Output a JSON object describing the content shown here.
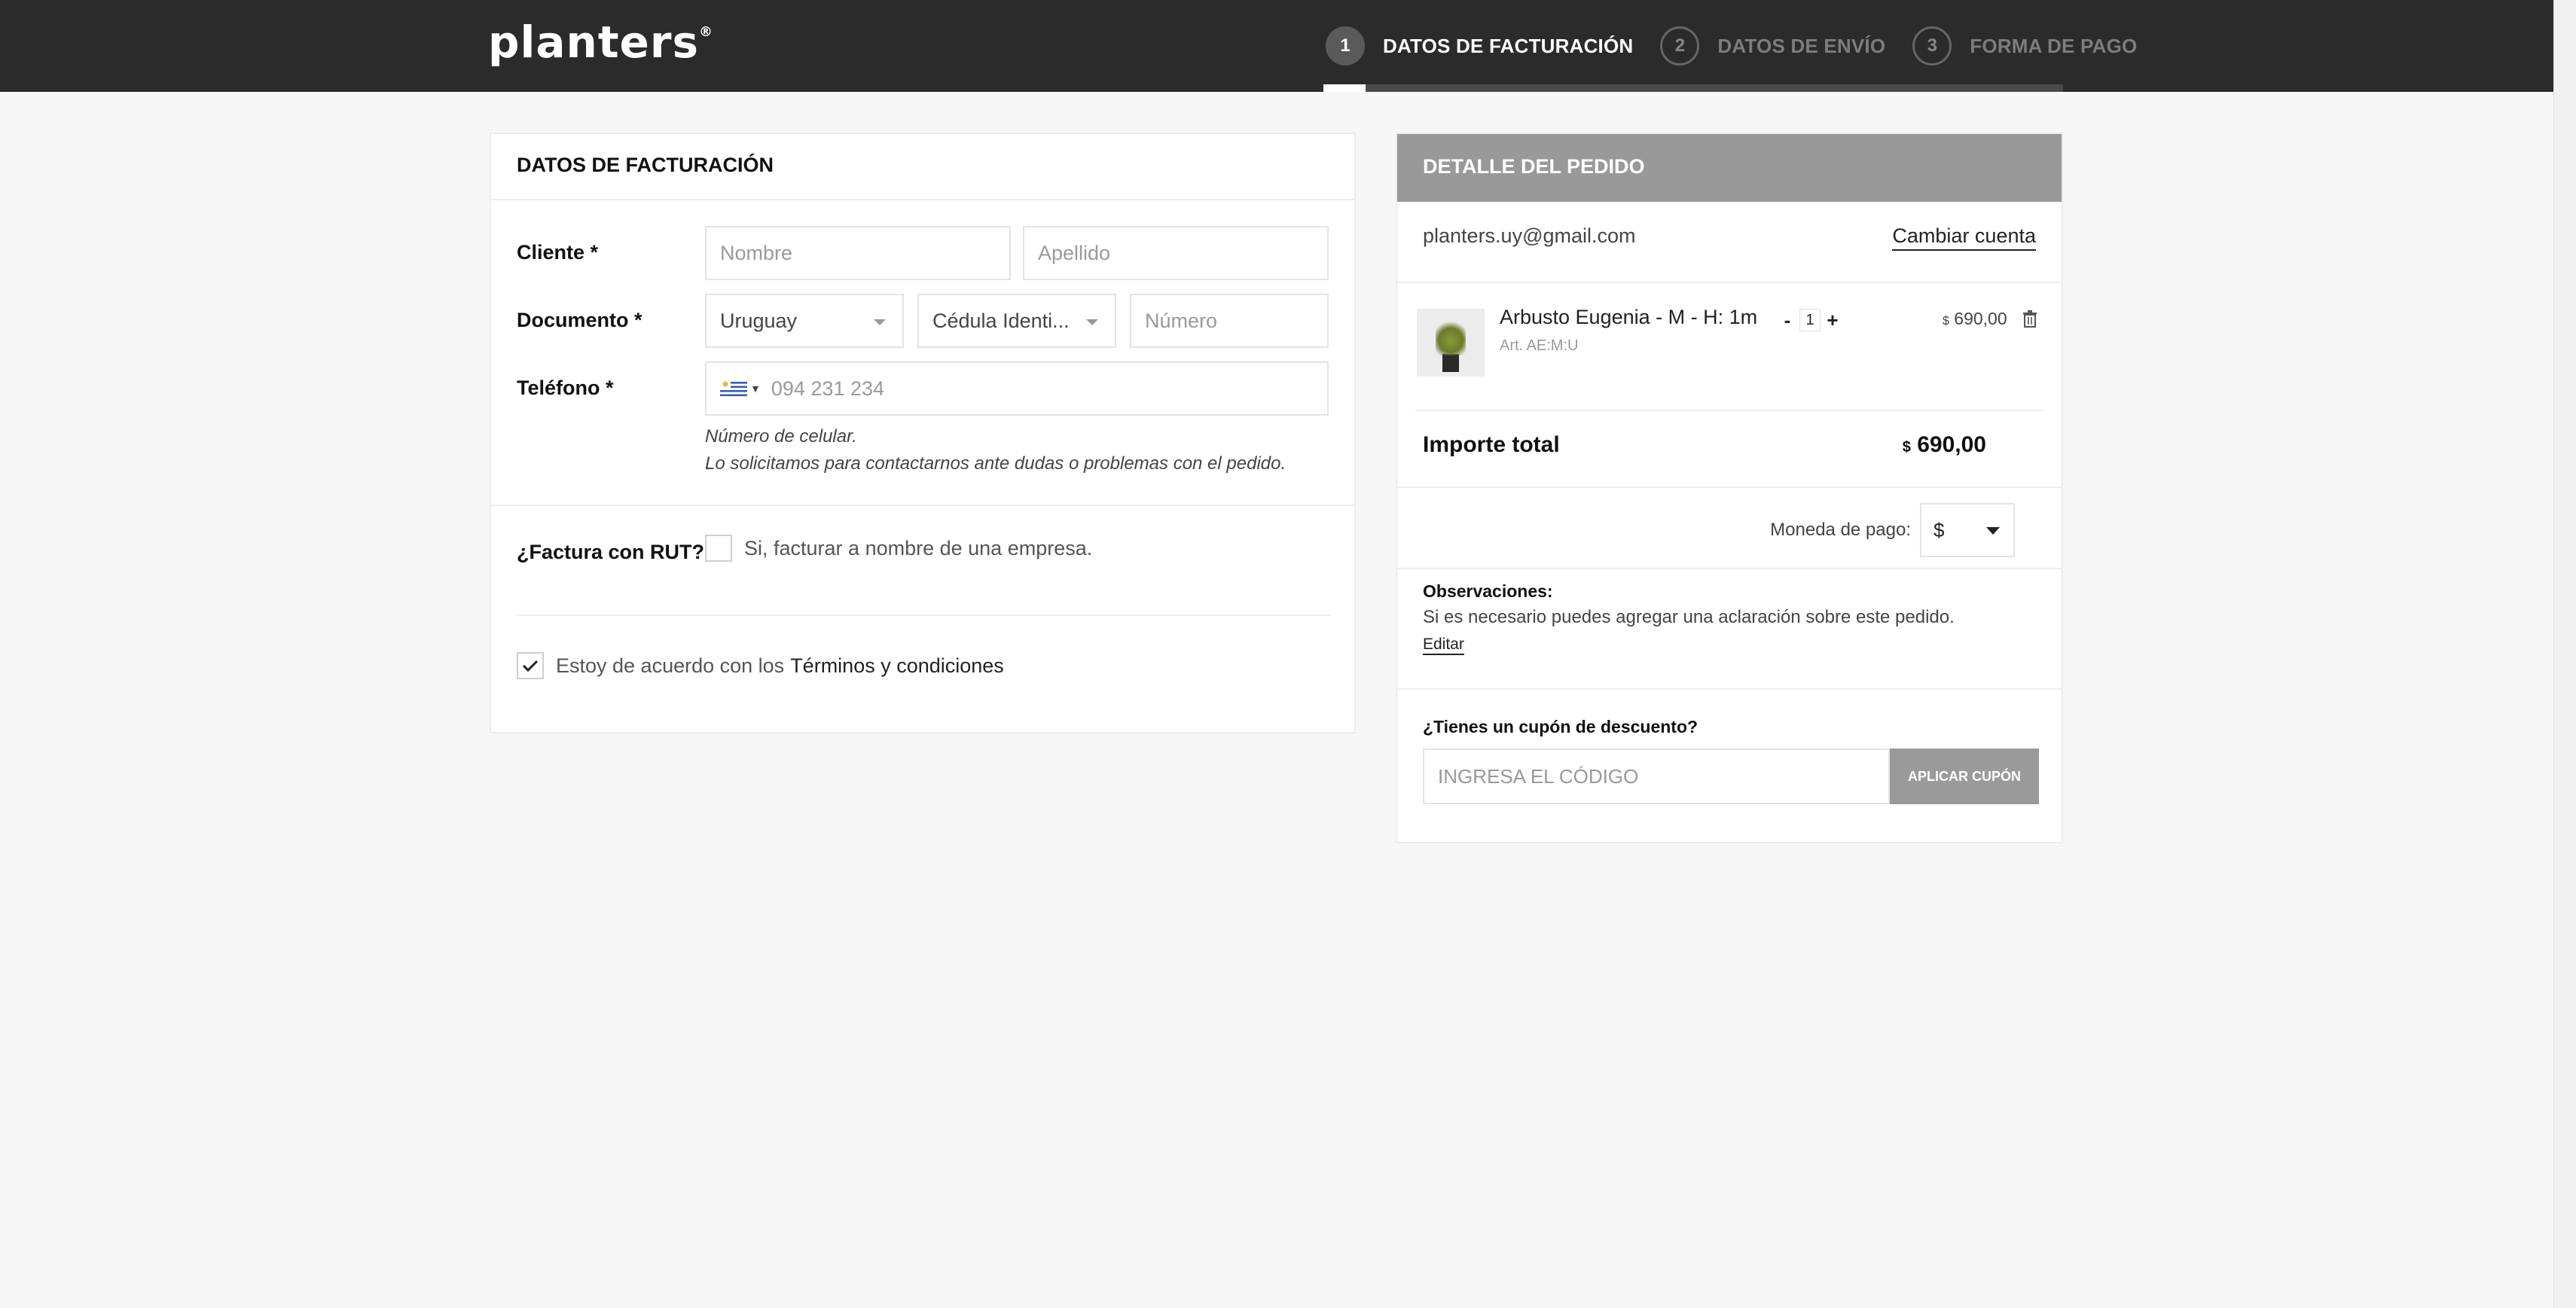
{
  "header": {
    "logo": "planters",
    "logo_mark": "®",
    "steps": [
      {
        "number": "1",
        "label": "DATOS DE FACTURACIÓN"
      },
      {
        "number": "2",
        "label": "DATOS DE ENVÍO"
      },
      {
        "number": "3",
        "label": "FORMA DE PAGO"
      }
    ],
    "active_step": 1
  },
  "billing": {
    "title": "DATOS DE FACTURACIÓN",
    "cliente_label": "Cliente *",
    "nombre_placeholder": "Nombre",
    "apellido_placeholder": "Apellido",
    "documento_label": "Documento *",
    "country_value": "Uruguay",
    "doc_type_value": "Cédula Identi...",
    "numero_placeholder": "Número",
    "telefono_label": "Teléfono *",
    "phone_placeholder": "094 231 234",
    "phone_flag_icon": "uruguay-flag-icon",
    "hint_line1": "Número de celular.",
    "hint_line2": "Lo solicitamos para contactarnos ante dudas o problemas con el pedido.",
    "rut_label": "¿Factura con RUT?",
    "rut_checkbox_text": "Si, facturar a nombre de una empresa.",
    "rut_checked": false,
    "terms_text": "Estoy de acuerdo con los",
    "terms_link": "Términos y condiciones",
    "terms_checked": true
  },
  "order": {
    "title": "DETALLE DEL PEDIDO",
    "email": "planters.uy@gmail.com",
    "change_account": "Cambiar cuenta",
    "product": {
      "name": "Arbusto Eugenia - M - H: 1m",
      "sku": "Art. AE:M:U",
      "qty": "1",
      "minus": "-",
      "plus": "+",
      "currency_symbol": "$",
      "price": "690,00"
    },
    "total_label": "Importe total",
    "total_currency": "$",
    "total_value": "690,00",
    "currency_label": "Moneda de pago:",
    "currency_value": "$",
    "observations_title": "Observaciones:",
    "observations_text": "Si es necesario puedes agregar una aclaración sobre este pedido.",
    "observations_edit": "Editar",
    "coupon_title": "¿Tienes un cupón de descuento?",
    "coupon_placeholder": "INGRESA EL CÓDIGO",
    "coupon_button": "APLICAR CUPÓN"
  },
  "colors": {
    "topbar": "#2b2b2b",
    "order_header": "#999999",
    "background": "#f7f7f7"
  }
}
